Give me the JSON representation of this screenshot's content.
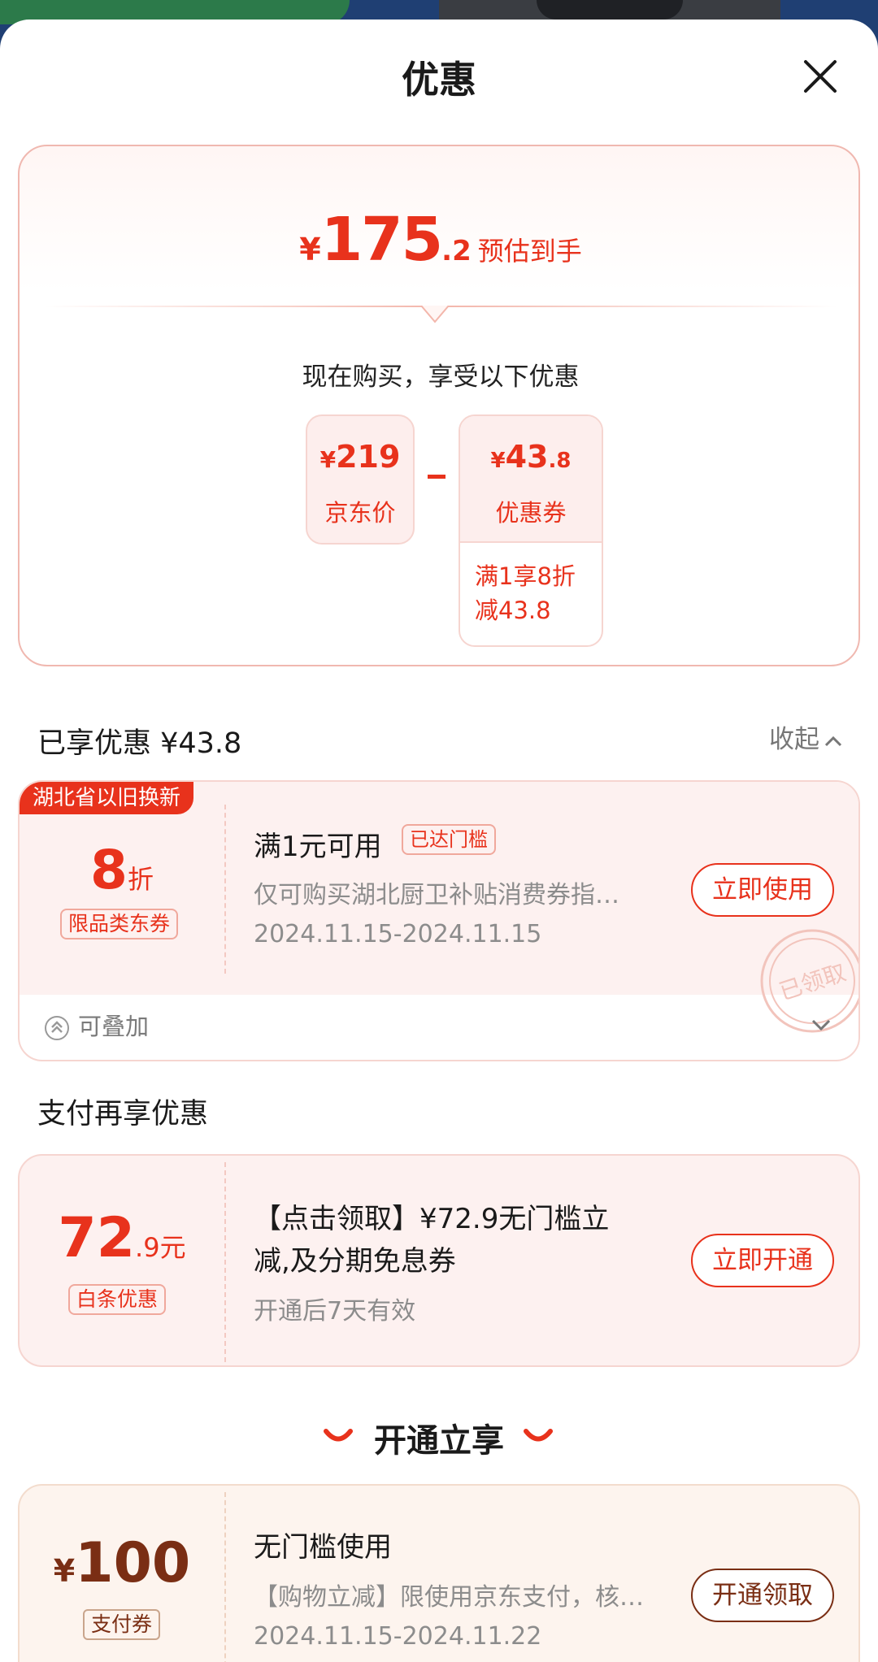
{
  "sheet": {
    "title": "优惠"
  },
  "summary": {
    "yen": "¥",
    "est_int": "175",
    "est_dec": ".2",
    "est_label": "预估到手",
    "buy_text": "现在购买，享受以下优惠",
    "jd_price": {
      "yen": "¥",
      "amount": "219",
      "label": "京东价"
    },
    "coupon": {
      "yen": "¥",
      "amount_int": "43",
      "amount_dec": ".8",
      "label": "优惠券",
      "rule_line1": "满1享8折",
      "rule_line2": "减43.8"
    }
  },
  "enjoyed": {
    "label": "已享优惠 ¥43.8",
    "collapse_label": "收起"
  },
  "coupon_trade_in": {
    "tag": "湖北省以旧换新",
    "value": "8",
    "unit": "折",
    "type": "限品类东券",
    "title": "满1元可用",
    "badge": "已达门槛",
    "desc": "仅可购买湖北厨卫补贴消费券指…",
    "dates": "2024.11.15-2024.11.15",
    "button": "立即使用",
    "stamp": "已领取",
    "stackable": "可叠加"
  },
  "pay_section": {
    "title": "支付再享优惠"
  },
  "coupon_baitiao": {
    "value_int": "72",
    "value_dec": ".9元",
    "type": "白条优惠",
    "title_line1": "【点击领取】¥72.9无门槛立",
    "title_line2": "减,及分期免息券",
    "validity": "开通后7天有效",
    "button": "立即开通"
  },
  "open_section": {
    "title": "开通立享"
  },
  "coupon_pay": {
    "yen": "¥",
    "value": "100",
    "type": "支付券",
    "title": "无门槛使用",
    "desc": "【购物立减】限使用京东支付，核…",
    "dates": "2024.11.15-2024.11.22",
    "button": "开通领取"
  },
  "colors": {
    "accent": "#e8321c",
    "brown": "#7a2e14",
    "pink_bg": "#fdf1f0"
  }
}
